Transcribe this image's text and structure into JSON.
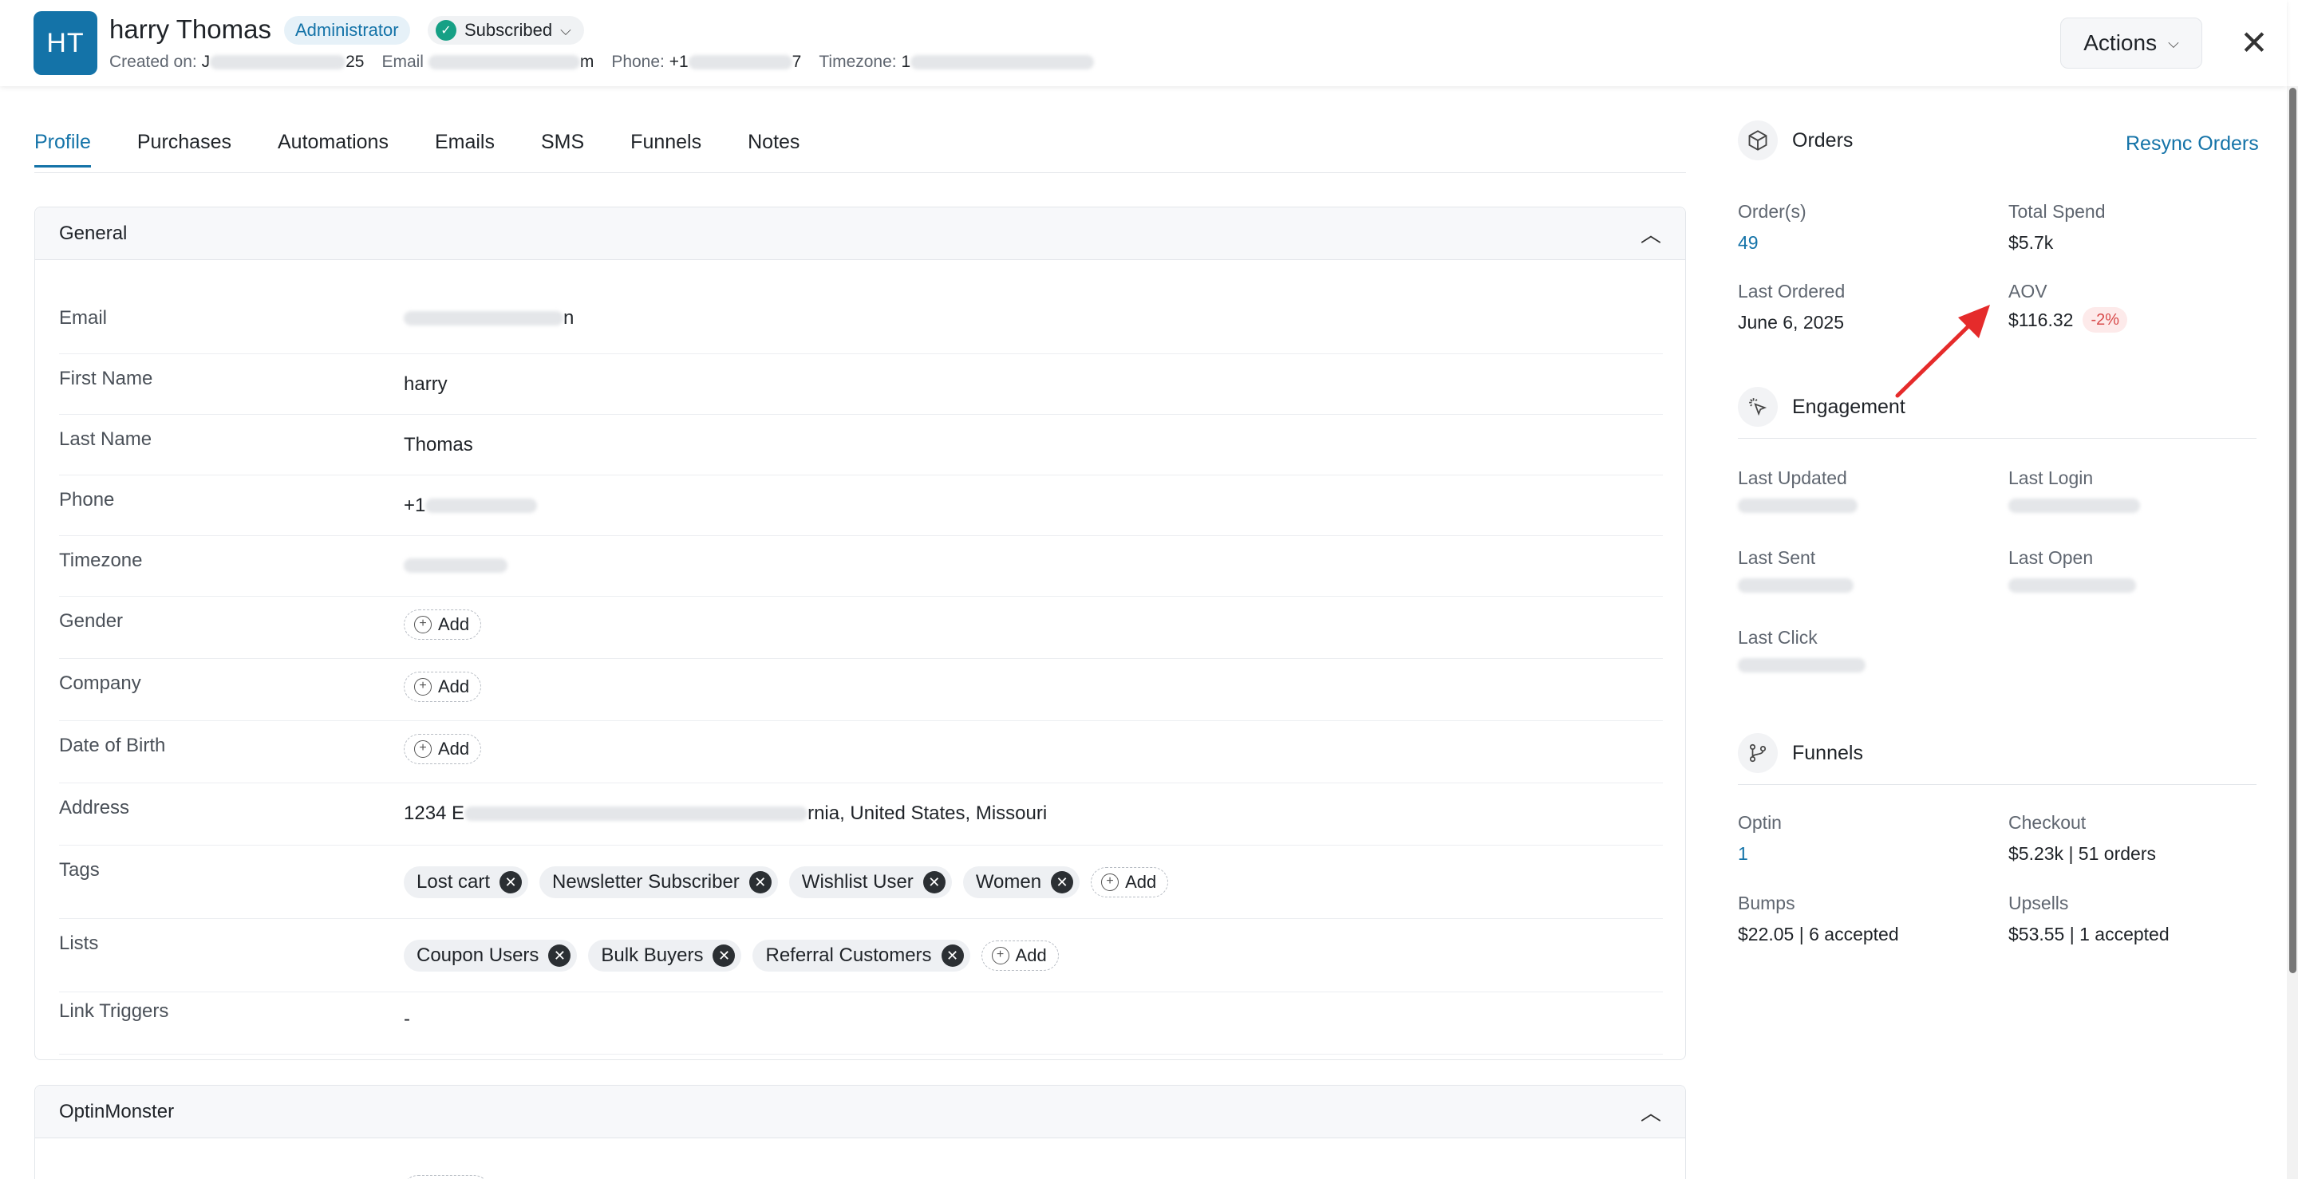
{
  "header": {
    "avatar_initials": "HT",
    "name": "harry Thomas",
    "role": "Administrator",
    "status": "Subscribed",
    "created_label": "Created on:",
    "created_value_start": "J",
    "created_value_end": "25",
    "email_label": "Email",
    "email_value_end": "m",
    "phone_label": "Phone:",
    "phone_value_start": "+1",
    "phone_value_end": "7",
    "timezone_label": "Timezone:",
    "timezone_value_start": "1",
    "actions_label": "Actions"
  },
  "tabs": [
    "Profile",
    "Purchases",
    "Automations",
    "Emails",
    "SMS",
    "Funnels",
    "Notes"
  ],
  "general": {
    "title": "General",
    "fields": {
      "email_label": "Email",
      "email_value_end": "n",
      "first_name_label": "First Name",
      "first_name": "harry",
      "last_name_label": "Last Name",
      "last_name": "Thomas",
      "phone_label": "Phone",
      "phone_value_start": "+1",
      "timezone_label": "Timezone",
      "gender_label": "Gender",
      "company_label": "Company",
      "dob_label": "Date of Birth",
      "address_label": "Address",
      "address_start": "1234 E",
      "address_end": "rnia, United States, Missouri",
      "tags_label": "Tags",
      "lists_label": "Lists",
      "link_triggers_label": "Link Triggers",
      "link_triggers_value": "-"
    },
    "add_label": "Add",
    "tags": [
      "Lost cart",
      "Newsletter Subscriber",
      "Wishlist User",
      "Women"
    ],
    "lists": [
      "Coupon Users",
      "Bulk Buyers",
      "Referral Customers"
    ]
  },
  "optinmonster": {
    "title": "OptinMonster"
  },
  "orders": {
    "title": "Orders",
    "resync_label": "Resync Orders",
    "orders_label": "Order(s)",
    "orders_value": "49",
    "total_spend_label": "Total Spend",
    "total_spend_value": "$5.7k",
    "last_ordered_label": "Last Ordered",
    "last_ordered_value": "June 6, 2025",
    "aov_label": "AOV",
    "aov_value": "$116.32",
    "aov_delta": "-2%"
  },
  "engagement": {
    "title": "Engagement",
    "last_updated_label": "Last Updated",
    "last_login_label": "Last Login",
    "last_sent_label": "Last Sent",
    "last_open_label": "Last Open",
    "last_click_label": "Last Click"
  },
  "funnels": {
    "title": "Funnels",
    "optin_label": "Optin",
    "optin_value": "1",
    "checkout_label": "Checkout",
    "checkout_value": "$5.23k | 51 orders",
    "bumps_label": "Bumps",
    "bumps_value": "$22.05 | 6 accepted",
    "upsells_label": "Upsells",
    "upsells_value": "$53.55 | 1 accepted"
  },
  "colors": {
    "accent": "#1473a8",
    "subscribed": "#16a085",
    "negative": "#d84a4a",
    "annotation_arrow": "#e52b2b"
  }
}
